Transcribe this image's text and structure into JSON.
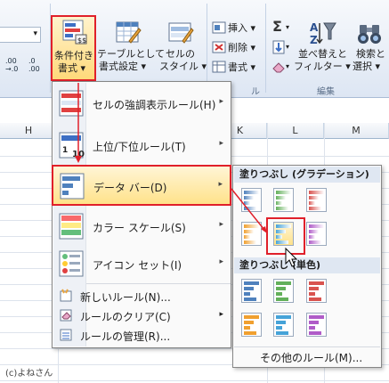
{
  "ribbon": {
    "cf_button": {
      "line1": "条件付き",
      "line2": "書式 ▾"
    },
    "table_button": {
      "line1": "テーブルとして",
      "line2": "書式設定 ▾"
    },
    "cellstyle_button": {
      "line1": "セルの",
      "line2": "スタイル ▾"
    },
    "insert_label": "挿入 ▾",
    "delete_label": "削除 ▾",
    "format_label": "書式 ▾",
    "sort_button": {
      "line1": "並べ替えと",
      "line2": "フィルター ▾"
    },
    "find_button": {
      "line1": "検索と",
      "line2": "選択 ▾"
    },
    "edit_group": "編集",
    "cell_group_partial": "ル",
    "num1": ".00\n→.0",
    "num2": ".0\n.00"
  },
  "columns": [
    "H",
    "K",
    "L",
    "M"
  ],
  "menu": {
    "items": [
      {
        "label": "セルの強調表示ルール(H)"
      },
      {
        "label": "上位/下位ルール(T)"
      },
      {
        "label": "データ バー(D)"
      },
      {
        "label": "カラー スケール(S)"
      },
      {
        "label": "アイコン セット(I)"
      }
    ],
    "small_items": [
      {
        "label": "新しいルール(N)..."
      },
      {
        "label": "ルールのクリア(C)"
      },
      {
        "label": "ルールの管理(R)..."
      }
    ]
  },
  "submenu": {
    "gradient_header": "塗りつぶし (グラデーション)",
    "solid_header": "塗りつぶし (単色)",
    "more_rules": "その他のルール(M)...",
    "gradient_colors": [
      "#4f81bd",
      "#63b05a",
      "#d9534f",
      "#f0a030",
      "#46a3d8",
      "#b05cc8"
    ],
    "solid_colors": [
      "#4f81bd",
      "#63b05a",
      "#d9534f",
      "#f0a030",
      "#46a3d8",
      "#b05cc8"
    ]
  },
  "copyright": "(c)よねさん"
}
